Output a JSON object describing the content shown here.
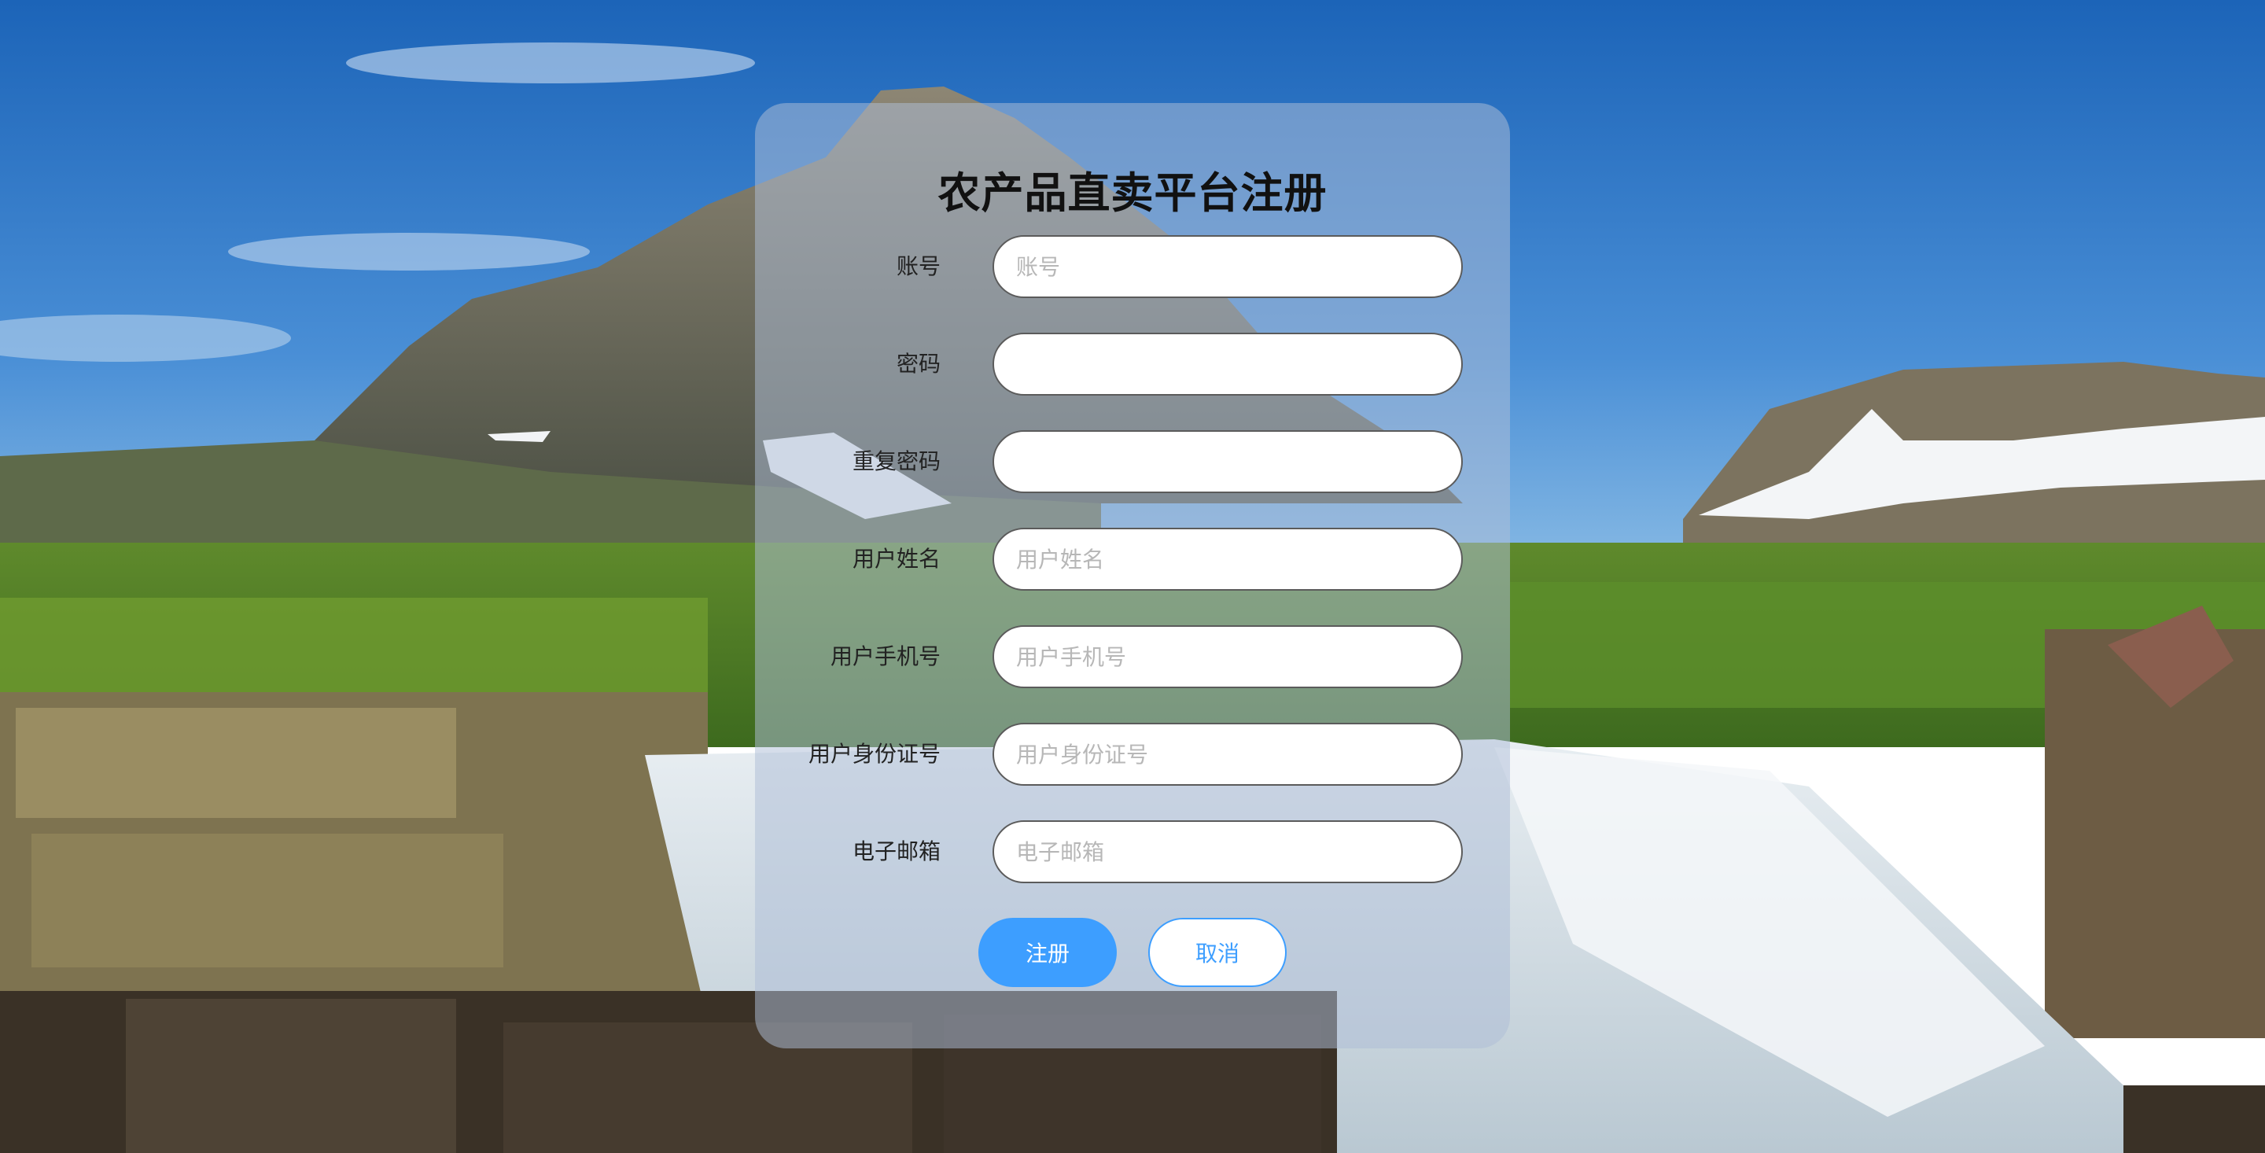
{
  "form": {
    "title": "农产品直卖平台注册",
    "fields": [
      {
        "label": "账号",
        "placeholder": "账号",
        "type": "text"
      },
      {
        "label": "密码",
        "placeholder": "",
        "type": "password"
      },
      {
        "label": "重复密码",
        "placeholder": "",
        "type": "password"
      },
      {
        "label": "用户姓名",
        "placeholder": "用户姓名",
        "type": "text"
      },
      {
        "label": "用户手机号",
        "placeholder": "用户手机号",
        "type": "text"
      },
      {
        "label": "用户身份证号",
        "placeholder": "用户身份证号",
        "type": "text"
      },
      {
        "label": "电子邮箱",
        "placeholder": "电子邮箱",
        "type": "text"
      }
    ],
    "buttons": {
      "register": "注册",
      "cancel": "取消"
    }
  },
  "colors": {
    "accent": "#3d9eff",
    "card_bg": "rgba(175,190,215,0.52)"
  }
}
